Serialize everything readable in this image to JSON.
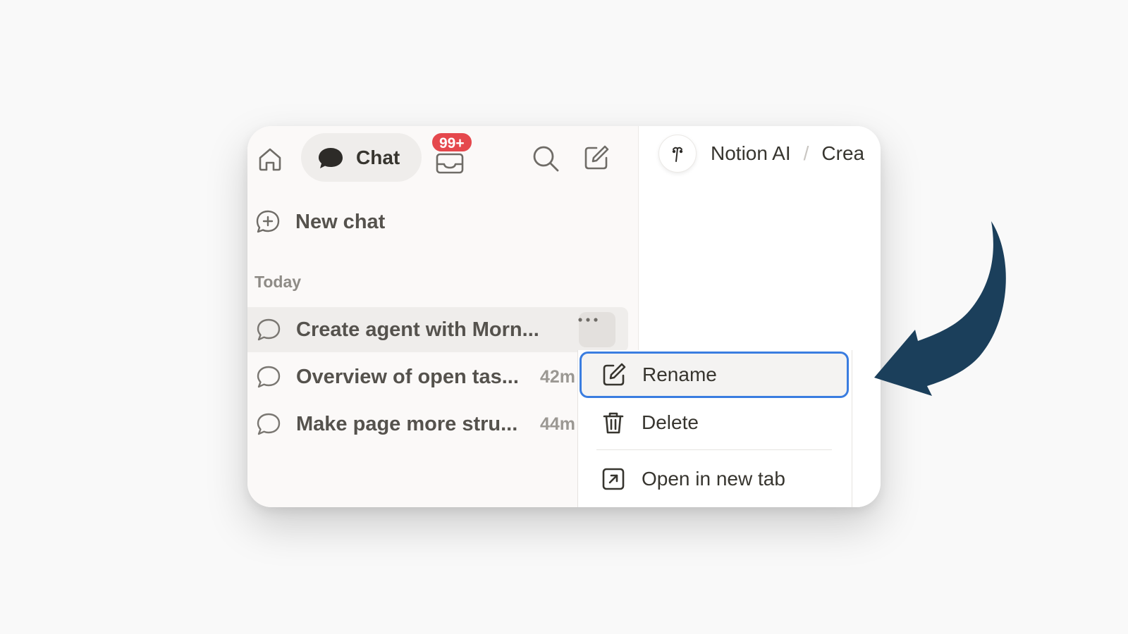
{
  "topbar": {
    "chat_label": "Chat",
    "inbox_badge": "99+",
    "icons": [
      "home-icon",
      "chat-bubble-icon",
      "inbox-icon",
      "search-icon",
      "compose-icon"
    ]
  },
  "sidebar": {
    "new_chat_label": "New chat",
    "section_label": "Today",
    "chats": [
      {
        "title": "Create agent with Morn...",
        "time": ""
      },
      {
        "title": "Overview of open tas...",
        "time": "42m"
      },
      {
        "title": "Make page more stru...",
        "time": "44m"
      }
    ]
  },
  "context_menu": {
    "items": [
      {
        "label": "Rename",
        "icon": "rename-icon"
      },
      {
        "label": "Delete",
        "icon": "trash-icon"
      },
      {
        "label": "Open in new tab",
        "icon": "open-external-icon"
      }
    ]
  },
  "header": {
    "breadcrumb": [
      "Notion AI",
      "Crea"
    ],
    "separator": "/"
  },
  "colors": {
    "badge": "#e5484d",
    "highlight_border": "#3a7de0",
    "arrow": "#1b3f5b",
    "sidebar_bg": "#fbf9f8"
  }
}
